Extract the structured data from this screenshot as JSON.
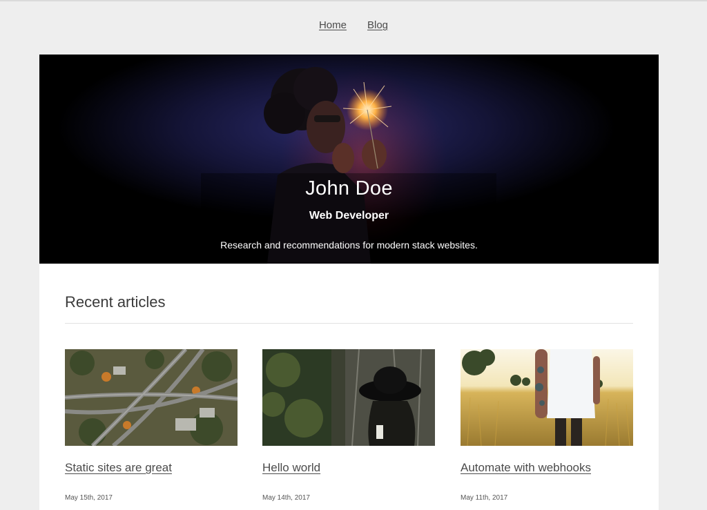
{
  "nav": {
    "items": [
      "Home",
      "Blog"
    ]
  },
  "hero": {
    "name": "John Doe",
    "role": "Web Developer",
    "tagline": "Research and recommendations for modern stack websites."
  },
  "recent": {
    "title": "Recent articles",
    "articles": [
      {
        "title": "Static sites are great",
        "date": "May 15th, 2017"
      },
      {
        "title": "Hello world",
        "date": "May 14th, 2017"
      },
      {
        "title": "Automate with webhooks",
        "date": "May 11th, 2017"
      }
    ]
  },
  "colors": {
    "page_background": "#eeeeee",
    "card_background": "#ffffff",
    "text": "#4a4a4a",
    "hero_background": "#000000"
  }
}
